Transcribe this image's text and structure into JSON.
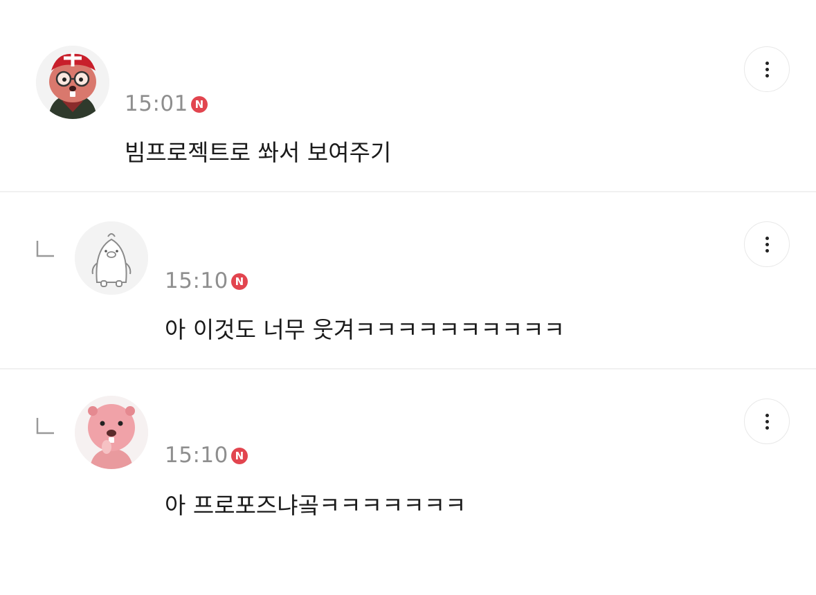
{
  "comments": [
    {
      "time": "15:01",
      "badge": "N",
      "text": "빔프로젝트로 쏴서 보여주기",
      "avatar_icon": "beaver-with-glasses-avatar-icon",
      "is_reply": false
    },
    {
      "time": "15:10",
      "badge": "N",
      "text": "아 이것도 너무 웃겨ㅋㅋㅋㅋㅋㅋㅋㅋㅋㅋ",
      "avatar_icon": "default-penguin-avatar-icon",
      "is_reply": true
    },
    {
      "time": "15:10",
      "badge": "N",
      "text": "아 프로포즈냐곸ㅋㅋㅋㅋㅋㅋㅋ",
      "avatar_icon": "pink-beaver-avatar-icon",
      "is_reply": true
    }
  ],
  "colors": {
    "badge": "#e2454f",
    "time": "#8e8e8e",
    "divider": "#f0f0f0"
  }
}
